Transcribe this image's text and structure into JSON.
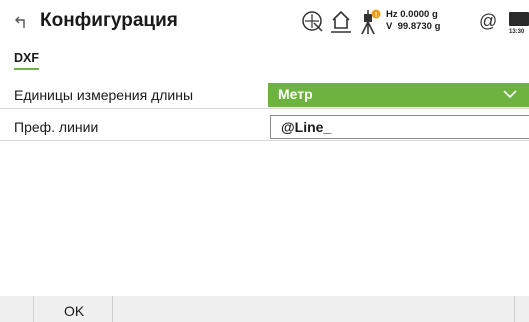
{
  "header": {
    "title": "Конфигурация",
    "hz": "Hz 0.0000 g",
    "v": "V  99.8730 g",
    "at_symbol": "@",
    "time": "13:30",
    "icons": [
      "back-arrow-icon",
      "crosshair-target-icon",
      "home-station-icon",
      "instrument-tripod-icon",
      "battery-icon"
    ],
    "warning_badge_color": "#f39c12"
  },
  "tab": {
    "label": "DXF",
    "accent_color": "#6cb33f"
  },
  "form": {
    "units_label": "Единицы измерения длины",
    "units_value": "Метр",
    "prefix_label": "Преф. линии",
    "prefix_value": "@Line_"
  },
  "footer": {
    "ok_label": "OK"
  }
}
